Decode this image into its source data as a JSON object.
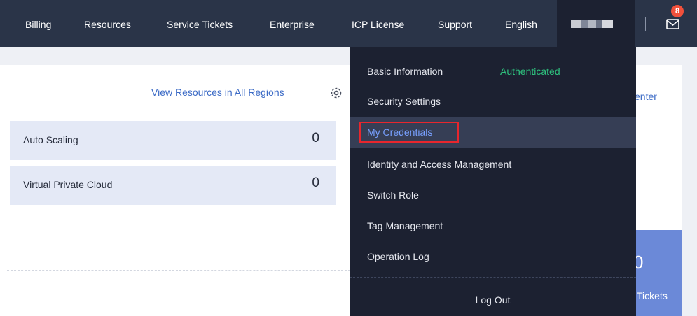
{
  "topnav": {
    "items": [
      {
        "label": "Billing"
      },
      {
        "label": "Resources"
      },
      {
        "label": "Service Tickets"
      },
      {
        "label": "Enterprise"
      },
      {
        "label": "ICP License"
      },
      {
        "label": "Support"
      },
      {
        "label": "English"
      }
    ],
    "unread_count": "8"
  },
  "dashboard": {
    "view_resources_link": "View Resources in All Regions",
    "resources": [
      {
        "label": "Auto Scaling",
        "count": "0"
      },
      {
        "label": "Virtual Private Cloud",
        "count": "0"
      }
    ],
    "partial_link": "enter",
    "tickets_count": "0",
    "tickets_label": "Tickets"
  },
  "dropdown": {
    "items": [
      {
        "label": "Basic Information"
      },
      {
        "label": "Security Settings"
      },
      {
        "label": "My Credentials"
      },
      {
        "label": "Identity and Access Management"
      },
      {
        "label": "Switch Role"
      },
      {
        "label": "Tag Management"
      },
      {
        "label": "Operation Log"
      }
    ],
    "auth_status": "Authenticated",
    "logout_label": "Log Out"
  },
  "colors": {
    "nav_bg": "#2a3448",
    "dropdown_bg": "#1c2131",
    "highlight_text": "#78a0ff",
    "authenticated": "#2ec27e",
    "badge": "#f1503b",
    "annotation_box": "#e8262d"
  }
}
